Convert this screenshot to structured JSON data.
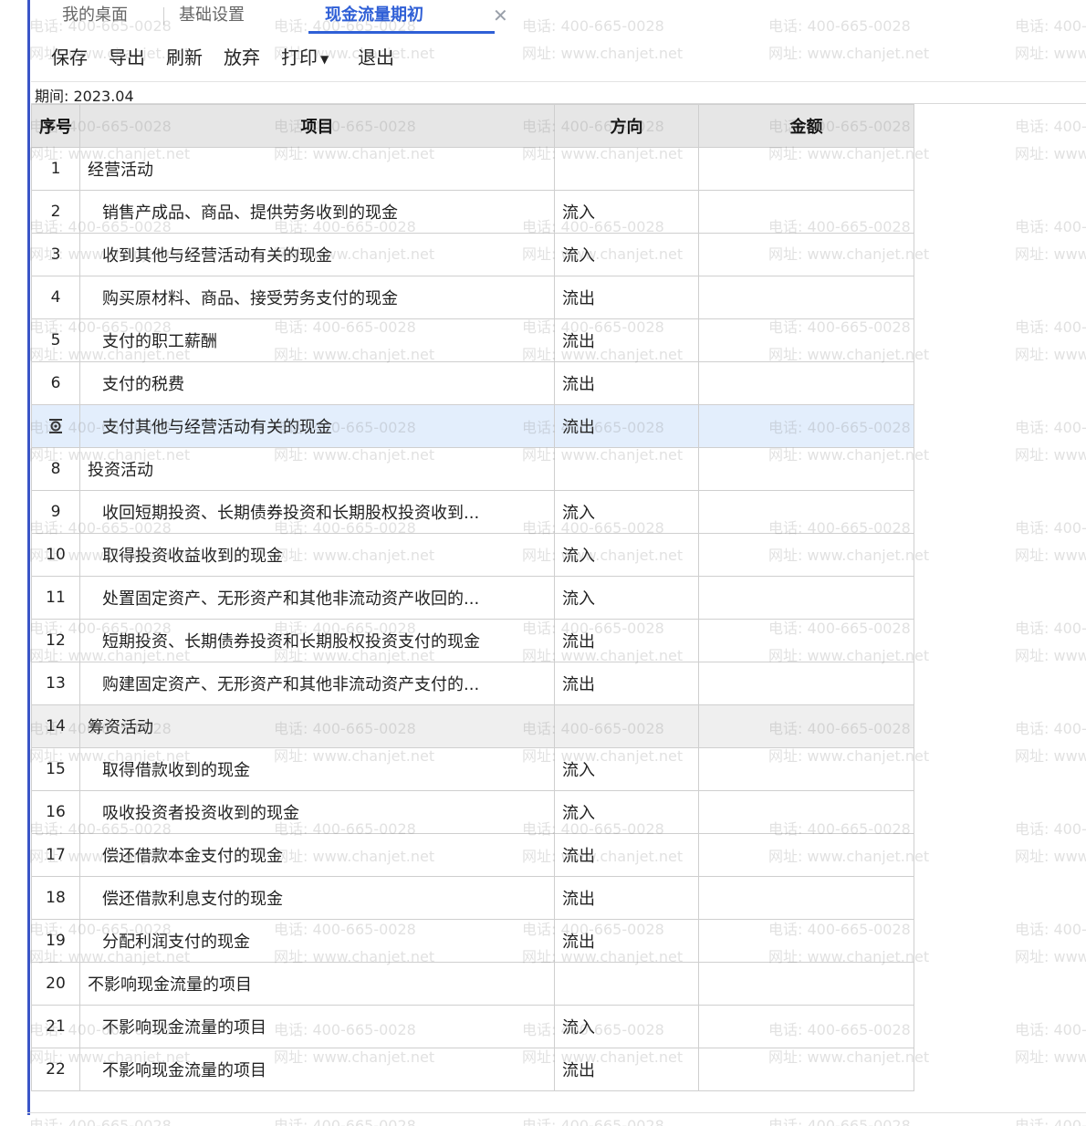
{
  "tabs": [
    {
      "label": "我的桌面",
      "active": false
    },
    {
      "label": "基础设置",
      "active": false
    },
    {
      "label": "现金流量期初",
      "active": true
    }
  ],
  "toolbar": {
    "save": "保存",
    "export": "导出",
    "refresh": "刷新",
    "discard": "放弃",
    "print": "打印",
    "exit": "退出"
  },
  "period": "期间: 2023.04",
  "table": {
    "headers": {
      "no": "序号",
      "item": "项目",
      "direction": "方向",
      "amount": "金额"
    },
    "rows": [
      {
        "no": "1",
        "item": "经营活动",
        "direction": "",
        "amount": "",
        "section": true
      },
      {
        "no": "2",
        "item": "销售产成品、商品、提供劳务收到的现金",
        "direction": "流入",
        "amount": ""
      },
      {
        "no": "3",
        "item": "收到其他与经营活动有关的现金",
        "direction": "流入",
        "amount": ""
      },
      {
        "no": "4",
        "item": "购买原材料、商品、接受劳务支付的现金",
        "direction": "流出",
        "amount": ""
      },
      {
        "no": "5",
        "item": "支付的职工薪酬",
        "direction": "流出",
        "amount": ""
      },
      {
        "no": "6",
        "item": "支付的税费",
        "direction": "流出",
        "amount": ""
      },
      {
        "no": "7",
        "item": "支付其他与经营活动有关的现金",
        "direction": "流出",
        "amount": "",
        "selected": true
      },
      {
        "no": "8",
        "item": "投资活动",
        "direction": "",
        "amount": "",
        "section": true
      },
      {
        "no": "9",
        "item": "收回短期投资、长期债券投资和长期股权投资收到...",
        "direction": "流入",
        "amount": ""
      },
      {
        "no": "10",
        "item": "取得投资收益收到的现金",
        "direction": "流入",
        "amount": ""
      },
      {
        "no": "11",
        "item": "处置固定资产、无形资产和其他非流动资产收回的...",
        "direction": "流入",
        "amount": ""
      },
      {
        "no": "12",
        "item": "短期投资、长期债券投资和长期股权投资支付的现金",
        "direction": "流出",
        "amount": ""
      },
      {
        "no": "13",
        "item": "购建固定资产、无形资产和其他非流动资产支付的...",
        "direction": "流出",
        "amount": ""
      },
      {
        "no": "14",
        "item": "筹资活动",
        "direction": "",
        "amount": "",
        "section": true,
        "gray": true
      },
      {
        "no": "15",
        "item": "取得借款收到的现金",
        "direction": "流入",
        "amount": ""
      },
      {
        "no": "16",
        "item": "吸收投资者投资收到的现金",
        "direction": "流入",
        "amount": ""
      },
      {
        "no": "17",
        "item": "偿还借款本金支付的现金",
        "direction": "流出",
        "amount": ""
      },
      {
        "no": "18",
        "item": "偿还借款利息支付的现金",
        "direction": "流出",
        "amount": ""
      },
      {
        "no": "19",
        "item": "分配利润支付的现金",
        "direction": "流出",
        "amount": ""
      },
      {
        "no": "20",
        "item": "不影响现金流量的项目",
        "direction": "",
        "amount": "",
        "section": true
      },
      {
        "no": "21",
        "item": "不影响现金流量的项目",
        "direction": "流入",
        "amount": ""
      },
      {
        "no": "22",
        "item": "不影响现金流量的项目",
        "direction": "流出",
        "amount": ""
      }
    ]
  },
  "watermark": {
    "phone": "电话: 400-665-0028",
    "site": "网址: www.chanjet.net"
  },
  "colors": {
    "accent": "#2f5fd6",
    "rail": "#3a55c8",
    "header_bg": "#e6e6e6",
    "selected_bg": "#e3eefc"
  },
  "icons": {
    "close": "close-icon",
    "print_menu": "chevron-down-icon",
    "row_edit": "row-edit-icon"
  }
}
